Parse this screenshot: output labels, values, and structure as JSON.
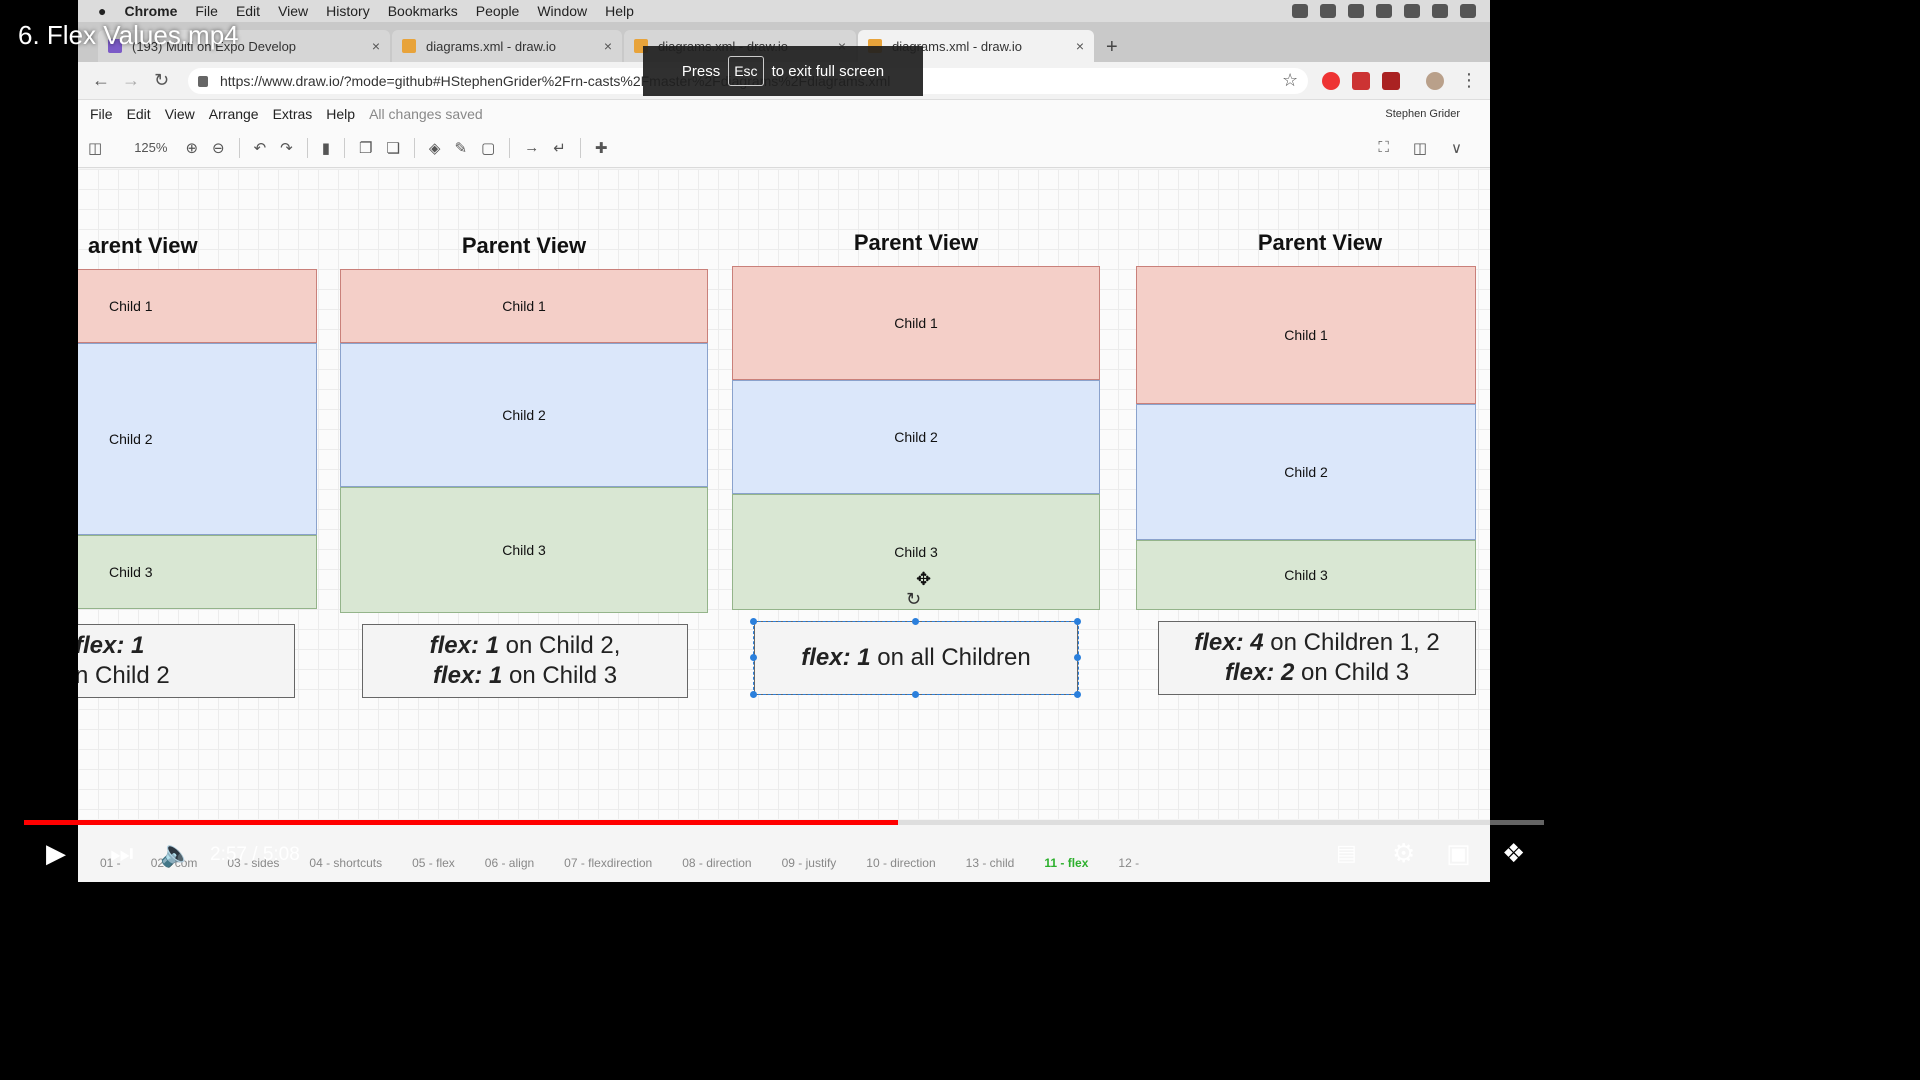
{
  "video": {
    "title": "6. Flex Values.mp4",
    "time": "2:57 / 5:08",
    "progress_fraction": 0.575,
    "chapters": [
      {
        "label": "01 - ",
        "current": false
      },
      {
        "label": "02 - com",
        "current": false
      },
      {
        "label": "03 - sides",
        "current": false
      },
      {
        "label": "04 - shortcuts",
        "current": false
      },
      {
        "label": "05 - flex",
        "current": false
      },
      {
        "label": "06 - align",
        "current": false
      },
      {
        "label": "07 - flexdirection",
        "current": false
      },
      {
        "label": "08 - direction",
        "current": false
      },
      {
        "label": "09 - justify",
        "current": false
      },
      {
        "label": "10 - direction",
        "current": false
      },
      {
        "label": "13 - child",
        "current": false
      },
      {
        "label": "11 - flex",
        "current": true
      },
      {
        "label": "12 - ",
        "current": false
      }
    ]
  },
  "menubar": {
    "apple": "",
    "items": [
      "Chrome",
      "File",
      "Edit",
      "View",
      "History",
      "Bookmarks",
      "People",
      "Window",
      "Help"
    ]
  },
  "tabs": [
    {
      "label": "(193) Multi on Expo Develop",
      "close": "×"
    },
    {
      "label": "diagrams.xml - draw.io",
      "close": "×"
    },
    {
      "label": "diagrams.xml - draw.io",
      "close": "×"
    },
    {
      "label": "diagrams.xml - draw.io",
      "close": "×"
    }
  ],
  "new_tab": "+",
  "address": {
    "url": "https://www.draw.io/?mode=github#HStephenGrider%2Frn-casts%2Fmaster%2Fdiagrams%2Fdiagrams.xml",
    "back": "←",
    "forward": "→",
    "reload": "↻",
    "star": "☆"
  },
  "toast": {
    "press": "Press",
    "key": "Esc",
    "message": "to exit full screen"
  },
  "drawio": {
    "menu": [
      "File",
      "Edit",
      "View",
      "Arrange",
      "Extras",
      "Help"
    ],
    "saved_status": "All changes saved",
    "user": "Stephen Grider",
    "zoom": "125%"
  },
  "diagrams": [
    {
      "title": "arent View",
      "children": [
        "Child 1",
        "Child 2",
        "Child 3"
      ],
      "caption_lines": [
        [
          "flex: 1",
          ""
        ],
        [
          "",
          "n Child 2"
        ]
      ]
    },
    {
      "title": "Parent View",
      "children": [
        "Child 1",
        "Child 2",
        "Child 3"
      ],
      "caption_lines": [
        [
          "flex: 1",
          " on Child 2,"
        ],
        [
          "flex: 1",
          " on Child 3"
        ]
      ]
    },
    {
      "title": "Parent View",
      "children": [
        "Child 1",
        "Child 2",
        "Child 3"
      ],
      "caption_lines": [
        [
          "flex: 1",
          " on all Children"
        ]
      ]
    },
    {
      "title": "Parent View",
      "children": [
        "Child 1",
        "Child 2",
        "Child 3"
      ],
      "caption_lines": [
        [
          "flex: 4",
          " on Children 1, 2"
        ],
        [
          "flex: 2",
          " on Child 3"
        ]
      ]
    }
  ],
  "colors": {
    "child1": "#f4cfc8",
    "child2": "#dbe7fa",
    "child3": "#d9e7d3",
    "progress": "#ff0000",
    "selection": "#2a7fdc"
  }
}
